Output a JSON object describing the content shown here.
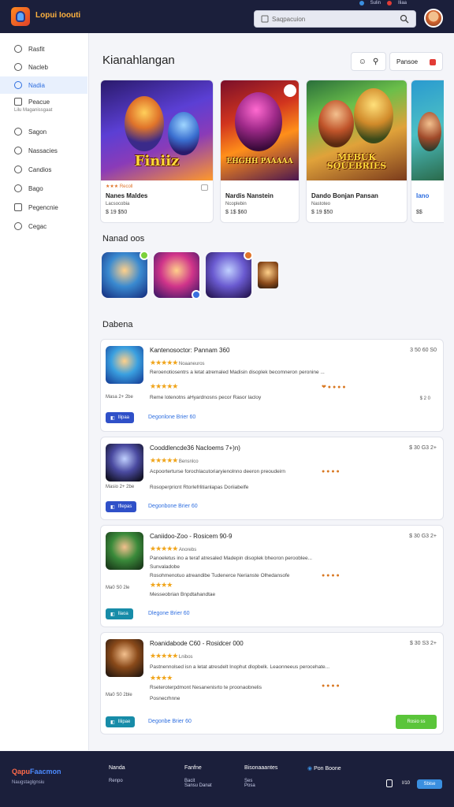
{
  "app": {
    "name": "Lopui Ioouti",
    "search_placeholder": "Saqpacuion"
  },
  "topbar": {
    "mini": [
      "Sulin",
      "Iliaa"
    ]
  },
  "sidebar": {
    "items": [
      {
        "label": "Rasfit",
        "icon": "home-icon"
      },
      {
        "label": "Nacleb",
        "icon": "grid-icon"
      },
      {
        "label": "Nadia",
        "icon": "compass-icon",
        "active": true
      },
      {
        "label": "Peacue",
        "icon": "monitor-icon"
      },
      {
        "label": "Sagon",
        "icon": "gamepad-icon"
      },
      {
        "label": "Nassacies",
        "icon": "heart-icon"
      },
      {
        "label": "Candios",
        "icon": "tag-icon"
      },
      {
        "label": "Bago",
        "icon": "clock-icon"
      },
      {
        "label": "Pegencnie",
        "icon": "mail-icon"
      },
      {
        "label": "Cegac",
        "icon": "gear-icon"
      }
    ],
    "sub_caption": "Lilu  Maganissgaat"
  },
  "main": {
    "title": "Kianahlangan",
    "toolbar": {
      "icons": [
        "chat-icon",
        "filter-icon"
      ],
      "button_label": "Pansoe"
    },
    "featured": [
      {
        "tag": "Recoll",
        "title": "Nanes Maldes",
        "subtitle": "Lacsocobia",
        "price": "$ 19 $50",
        "art_title": "Finiiz"
      },
      {
        "tag": "",
        "title": "Nardis Nanstein",
        "subtitle": "Ncoplebin",
        "price": "$ 1$ $60",
        "art_title": "EHGHH PAAAAA"
      },
      {
        "tag": "",
        "title": "Dando Bonjan  Pansan",
        "subtitle": "Nastoteo",
        "price": "$ 19 $50",
        "art_title": "MEBUK SQUEBRIES"
      },
      {
        "tag": "",
        "title": "Iano",
        "subtitle": "",
        "price": "$$",
        "art_title": ""
      }
    ],
    "section2": "Nanad oos",
    "section3": "Dabena",
    "list": [
      {
        "title": "Kantenosoctor:  Pannam 360",
        "stars": "★★★★★",
        "stars_text": "Noaaneuros",
        "desc": "Reroenotiosentrs  a letat atremaled Madisin disoplek  becomneron peronine ...",
        "stars2": "★★★★★",
        "desc2": "Reme  lotenotns aHyardnosns pecor  Rasor lacloy",
        "date": "Masa 2+ 2be",
        "meta": "3 50 60 S0",
        "meta2": "$ 2 0",
        "pill": "Ilipaa",
        "link": "Degonlone  Brier 60"
      },
      {
        "title": "Cooddlencde36  Nacloems 7+)n)",
        "stars": "★★★★★",
        "stars_text": "Bensnlco",
        "desc": "Acpoorterturse  forochlacutoriaryienolnno deeron preoudeirn",
        "desc2": "Rosoperpricnt  Rtorlefrlitianlapas Doriiabelfe",
        "date": "Masio 2+ 2be",
        "meta": "$ 30 G3 2+",
        "pill": "Iflepas",
        "link": "Degonbone  Brier 60"
      },
      {
        "title": "Caniidoo-Zoo -  Rosicem  90-9",
        "stars": "★★★★★",
        "stars_text": "Anorebs",
        "desc": "Panoeletus ino a teraf atresaled Madepin disoplek  bheoron perooblee...",
        "desc1b": "Sunvaladobe",
        "desc2": "Rosohmenotuo atreandibe Tudenerce Nerianste Olhedansofe",
        "stars2": "★★★★",
        "desc3": "Messeobrian  Bnpdtahandtae",
        "date": "Ma0 S0  2le",
        "meta": "$ 30 G3 2+",
        "pill": "Ilaoa",
        "link": "Dlegone  Brier 60"
      },
      {
        "title": "Roanidabode  C60 -  Rosidcer  000",
        "stars": "★★★★★",
        "stars_text": "Lnibos",
        "desc": "Pastnennolsed isn a letat atresdelt Inophut dlopbelk. Leaonneeus perocehate...",
        "stars2": "★★★★",
        "desc2": "Rseteroterpdmont Nesanenisrto te proonaobnelis",
        "date": "Ma0 S0  2ble",
        "desc3": "Posnecrhnne",
        "meta": "$ 30 S3 2+",
        "pill": "Iliipae",
        "link": "Degonbe  Brier 60",
        "get_label": "Rosio  ss"
      }
    ]
  },
  "footer": {
    "brand_a": "Qapu",
    "brand_b": "Faacmon",
    "brand_sub": "Naugstaglgnsiu",
    "cols": [
      {
        "h": "Nanda",
        "items": [
          "Renpo"
        ]
      },
      {
        "h": "Fanfne",
        "items": [
          "Bacit",
          "Sansu Danat"
        ]
      },
      {
        "h": "Bisonaaantes",
        "items": [
          "Ses",
          "Posa"
        ]
      },
      {
        "h": "Pon Boone",
        "items": []
      }
    ],
    "small": "I/10",
    "badge": "Sbise"
  }
}
